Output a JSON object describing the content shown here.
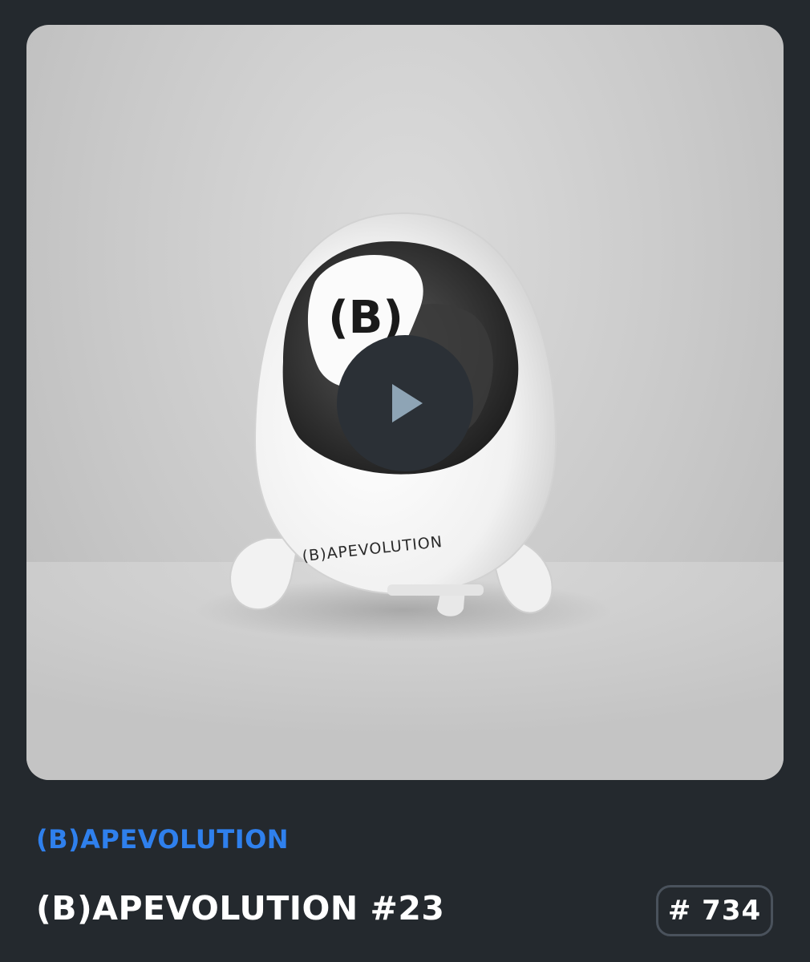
{
  "media": {
    "artwork_logo_text": "(B)",
    "artwork_brand_text": "(B)APEVOLUTION",
    "play_icon": "play-icon"
  },
  "collection": {
    "name": "(B)APEVOLUTION"
  },
  "item": {
    "title": "(B)APEVOLUTION #23",
    "rank": "# 734"
  },
  "colors": {
    "background": "#24292e",
    "accent": "#2f80ed",
    "badge_border": "#4a525c"
  }
}
